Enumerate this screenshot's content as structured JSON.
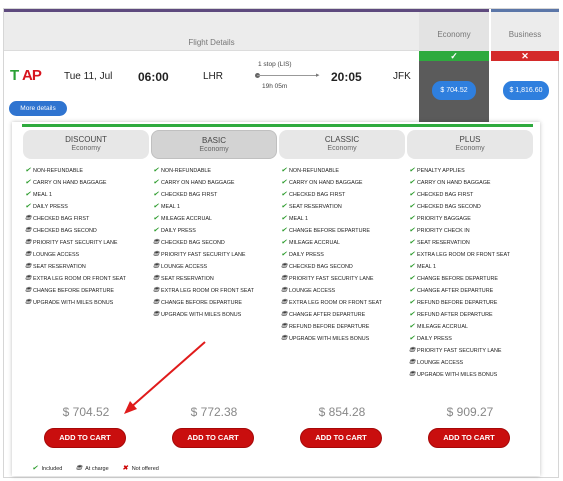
{
  "header": {
    "flight_details": "Flight Details",
    "economy": "Economy",
    "business": "Business",
    "economy_indicator": "✓",
    "business_indicator": "✕"
  },
  "flight": {
    "airline_logo": "TAP",
    "date": "Tue 11, Jul",
    "departure_time": "06:00",
    "departure_airport": "LHR",
    "stops": "1 stop (LIS)",
    "duration": "19h 05m",
    "arrival_time": "20:05",
    "arrival_airport": "JFK",
    "more_details": "More details",
    "economy_price": "$ 704.52",
    "business_price": "$ 1,816.60"
  },
  "fares": [
    {
      "name": "DISCOUNT",
      "class": "Economy",
      "price": "$ 704.52",
      "cart": "ADD TO CART",
      "features": [
        {
          "s": "inc",
          "t": "NON-REFUNDABLE"
        },
        {
          "s": "inc",
          "t": "CARRY ON HAND BAGGAGE"
        },
        {
          "s": "inc",
          "t": "MEAL 1"
        },
        {
          "s": "inc",
          "t": "DAILY PRESS"
        },
        {
          "s": "chg",
          "t": "CHECKED BAG FIRST"
        },
        {
          "s": "chg",
          "t": "CHECKED BAG SECOND"
        },
        {
          "s": "chg",
          "t": "PRIORITY FAST SECURITY LANE"
        },
        {
          "s": "chg",
          "t": "LOUNGE ACCESS"
        },
        {
          "s": "chg",
          "t": "SEAT RESERVATION"
        },
        {
          "s": "chg",
          "t": "EXTRA LEG ROOM OR FRONT SEAT"
        },
        {
          "s": "chg",
          "t": "CHANGE BEFORE DEPARTURE"
        },
        {
          "s": "chg",
          "t": "UPGRADE WITH MILES BONUS"
        }
      ]
    },
    {
      "name": "BASIC",
      "class": "Economy",
      "price": "$ 772.38",
      "cart": "ADD TO CART",
      "features": [
        {
          "s": "inc",
          "t": "NON-REFUNDABLE"
        },
        {
          "s": "inc",
          "t": "CARRY ON HAND BAGGAGE"
        },
        {
          "s": "inc",
          "t": "CHECKED BAG FIRST"
        },
        {
          "s": "inc",
          "t": "MEAL 1"
        },
        {
          "s": "inc",
          "t": "MILEAGE ACCRUAL"
        },
        {
          "s": "inc",
          "t": "DAILY PRESS"
        },
        {
          "s": "chg",
          "t": "CHECKED BAG SECOND"
        },
        {
          "s": "chg",
          "t": "PRIORITY FAST SECURITY LANE"
        },
        {
          "s": "chg",
          "t": "LOUNGE ACCESS"
        },
        {
          "s": "chg",
          "t": "SEAT RESERVATION"
        },
        {
          "s": "chg",
          "t": "EXTRA LEG ROOM OR FRONT SEAT"
        },
        {
          "s": "chg",
          "t": "CHANGE BEFORE DEPARTURE"
        },
        {
          "s": "chg",
          "t": "UPGRADE WITH MILES BONUS"
        }
      ]
    },
    {
      "name": "CLASSIC",
      "class": "Economy",
      "price": "$ 854.28",
      "cart": "ADD TO CART",
      "features": [
        {
          "s": "inc",
          "t": "NON-REFUNDABLE"
        },
        {
          "s": "inc",
          "t": "CARRY ON HAND BAGGAGE"
        },
        {
          "s": "inc",
          "t": "CHECKED BAG FIRST"
        },
        {
          "s": "inc",
          "t": "SEAT RESERVATION"
        },
        {
          "s": "inc",
          "t": "MEAL 1"
        },
        {
          "s": "inc",
          "t": "CHANGE BEFORE DEPARTURE"
        },
        {
          "s": "inc",
          "t": "MILEAGE ACCRUAL"
        },
        {
          "s": "inc",
          "t": "DAILY PRESS"
        },
        {
          "s": "chg",
          "t": "CHECKED BAG SECOND"
        },
        {
          "s": "chg",
          "t": "PRIORITY FAST SECURITY LANE"
        },
        {
          "s": "chg",
          "t": "LOUNGE ACCESS"
        },
        {
          "s": "chg",
          "t": "EXTRA LEG ROOM OR FRONT SEAT"
        },
        {
          "s": "chg",
          "t": "CHANGE AFTER DEPARTURE"
        },
        {
          "s": "chg",
          "t": "REFUND BEFORE DEPARTURE"
        },
        {
          "s": "chg",
          "t": "UPGRADE WITH MILES BONUS"
        }
      ]
    },
    {
      "name": "PLUS",
      "class": "Economy",
      "price": "$ 909.27",
      "cart": "ADD TO CART",
      "features": [
        {
          "s": "inc",
          "t": "PENALTY APPLIES"
        },
        {
          "s": "inc",
          "t": "CARRY ON HAND BAGGAGE"
        },
        {
          "s": "inc",
          "t": "CHECKED BAG FIRST"
        },
        {
          "s": "inc",
          "t": "CHECKED BAG SECOND"
        },
        {
          "s": "inc",
          "t": "PRIORITY BAGGAGE"
        },
        {
          "s": "inc",
          "t": "PRIORITY CHECK IN"
        },
        {
          "s": "inc",
          "t": "SEAT RESERVATION"
        },
        {
          "s": "inc",
          "t": "EXTRA LEG ROOM OR FRONT SEAT"
        },
        {
          "s": "inc",
          "t": "MEAL 1"
        },
        {
          "s": "inc",
          "t": "CHANGE BEFORE DEPARTURE"
        },
        {
          "s": "inc",
          "t": "CHANGE AFTER DEPARTURE"
        },
        {
          "s": "inc",
          "t": "REFUND BEFORE DEPARTURE"
        },
        {
          "s": "inc",
          "t": "REFUND AFTER DEPARTURE"
        },
        {
          "s": "inc",
          "t": "MILEAGE ACCRUAL"
        },
        {
          "s": "inc",
          "t": "DAILY PRESS"
        },
        {
          "s": "chg",
          "t": "PRIORITY FAST SECURITY LANE"
        },
        {
          "s": "chg",
          "t": "LOUNGE ACCESS"
        },
        {
          "s": "chg",
          "t": "UPGRADE WITH MILES BONUS"
        }
      ]
    }
  ],
  "legend": {
    "included": "Included",
    "at_charge": "At charge",
    "not_offered": "Not offered"
  },
  "colors": {
    "accent_purple": "#5e4a7e",
    "included_green": "#2eaa3e",
    "not_offered_red": "#d42a2a",
    "price_button_blue": "#2f7fde",
    "cart_red": "#c90e0e"
  },
  "icons": {
    "included": "check-icon",
    "at_charge": "charge-icon",
    "not_offered": "cross-icon"
  }
}
